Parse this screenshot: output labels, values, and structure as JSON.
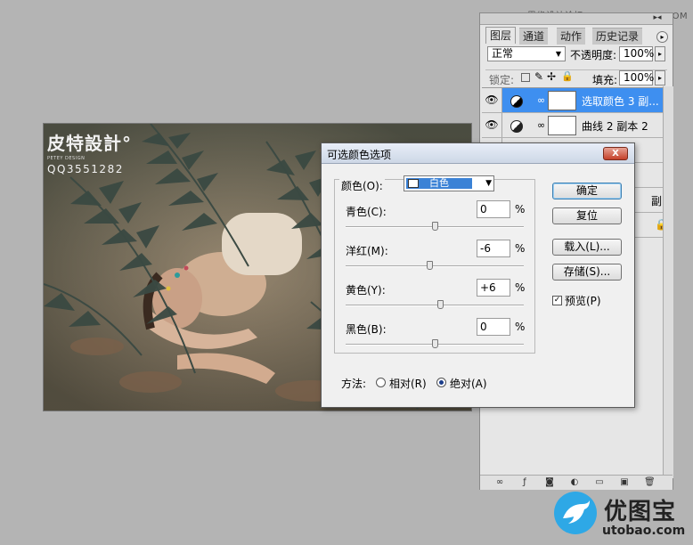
{
  "top_watermark": "思缘设计论坛 www.MISSYUAN.COM",
  "photo": {
    "logo_brand": "皮特設計°",
    "logo_sub": "PETEY DESIGN",
    "logo_qq": "QQ3551282"
  },
  "layers_panel": {
    "collapse_label": "▸◂",
    "tabs": [
      {
        "label": "图层",
        "active": true
      },
      {
        "label": "通道",
        "active": false
      },
      {
        "label": "动作",
        "active": false
      },
      {
        "label": "历史记录",
        "active": false
      }
    ],
    "blend_mode": "正常",
    "opacity_label": "不透明度:",
    "opacity_value": "100%",
    "lock_label": "锁定:",
    "fill_label": "填充:",
    "fill_value": "100%",
    "layers": [
      {
        "name": "选取颜色 3 副...",
        "selected": true
      },
      {
        "name": "曲线 2 副本 2",
        "selected": false
      },
      {
        "name": "副",
        "selected": false
      }
    ]
  },
  "dialog": {
    "title": "可选颜色选项",
    "close_label": "X",
    "color_label": "颜色(O):",
    "color_value": "白色",
    "sliders": [
      {
        "label": "青色(C):",
        "value": "0",
        "unit": "%",
        "position": 0.5
      },
      {
        "label": "洋红(M):",
        "value": "-6",
        "unit": "%",
        "position": 0.47
      },
      {
        "label": "黄色(Y):",
        "value": "+6",
        "unit": "%",
        "position": 0.53
      },
      {
        "label": "黑色(B):",
        "value": "0",
        "unit": "%",
        "position": 0.5
      }
    ],
    "buttons": {
      "ok": "确定",
      "reset": "复位",
      "load": "载入(L)...",
      "save": "存储(S)..."
    },
    "preview_label": "预览(P)",
    "preview_checked": true,
    "method_label": "方法:",
    "method_relative": "相对(R)",
    "method_absolute": "绝对(A)",
    "method_selected": "absolute"
  },
  "brand": {
    "name": "优图宝",
    "url": "utobao.com"
  },
  "colors": {
    "selection_blue": "#3e8ff0",
    "color_swatch": "#3b82d6",
    "brand_blue": "#2ea8e6"
  }
}
